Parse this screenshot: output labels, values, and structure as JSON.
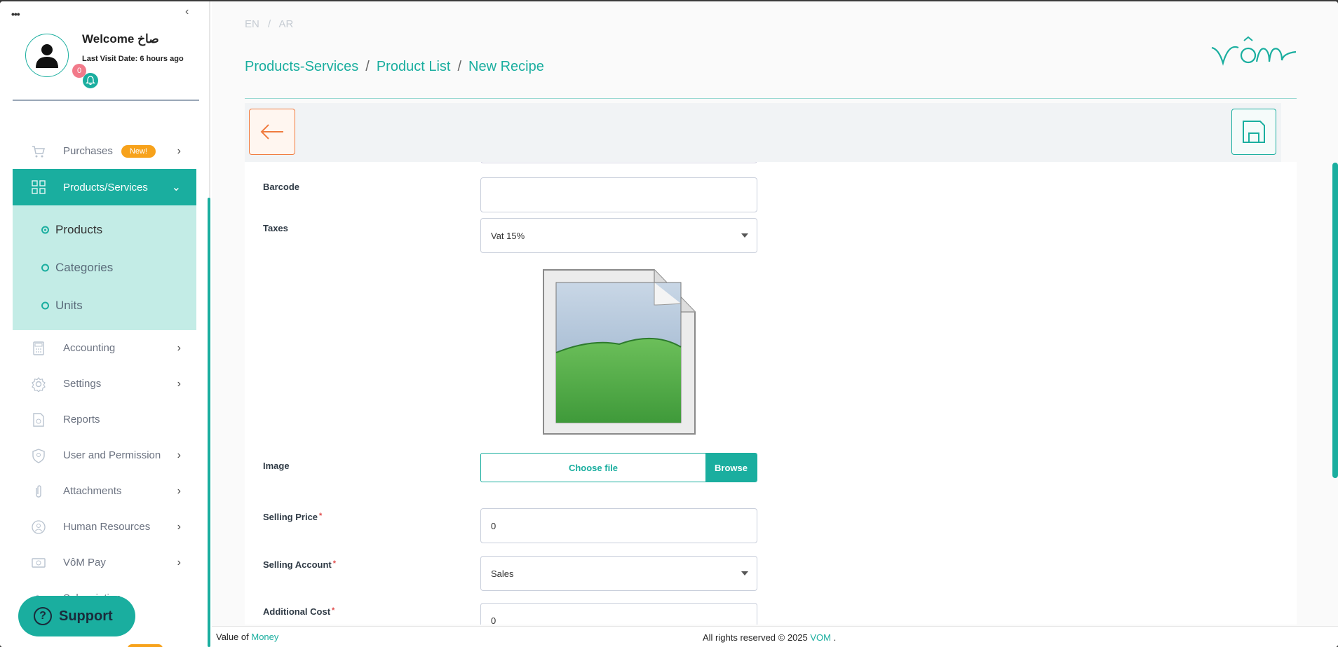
{
  "sidebar": {
    "welcome": "Welcome صاخ",
    "last_visit": "Last Visit Date: 6 hours ago",
    "notification_count": "0",
    "items": [
      {
        "label": "Purchases",
        "badge": "New!",
        "icon": "cart-icon"
      },
      {
        "label": "Products/Services",
        "icon": "grid-icon"
      },
      {
        "label": "Accounting",
        "icon": "calculator-icon"
      },
      {
        "label": "Settings",
        "icon": "gear-icon"
      },
      {
        "label": "Reports",
        "icon": "report-icon"
      },
      {
        "label": "User and Permission",
        "icon": "shield-icon"
      },
      {
        "label": "Attachments",
        "icon": "paperclip-icon"
      },
      {
        "label": "Human Resources",
        "icon": "people-icon"
      },
      {
        "label": "VôM Pay",
        "icon": "pay-icon"
      },
      {
        "label": "Subscription",
        "icon": "hand-icon"
      }
    ],
    "submenu": [
      "Products",
      "Categories",
      "Units"
    ],
    "support": "Support"
  },
  "header": {
    "lang_en": "EN",
    "lang_sep": "/",
    "lang_ar": "AR",
    "breadcrumb": [
      "Products-Services",
      "Product List",
      "New Recipe"
    ],
    "breadcrumb_sep": "/"
  },
  "form": {
    "barcode_label": "Barcode",
    "barcode_value": "",
    "taxes_label": "Taxes",
    "taxes_value": "Vat 15%",
    "image_label": "Image",
    "choose_file": "Choose file",
    "browse": "Browse",
    "selling_price_label": "Selling Price",
    "selling_price_value": "0",
    "selling_account_label": "Selling Account",
    "selling_account_value": "Sales",
    "additional_cost_label": "Additional Cost",
    "additional_cost_value": "0",
    "required_mark": "*"
  },
  "footer": {
    "value_of": "Value of",
    "money": "Money",
    "rights": "All rights reserved © 2025",
    "brand": "VOM",
    "dot": "."
  },
  "colors": {
    "accent": "#1aae9f",
    "back_button": "#f07b3f",
    "badge": "#f7a21b"
  }
}
